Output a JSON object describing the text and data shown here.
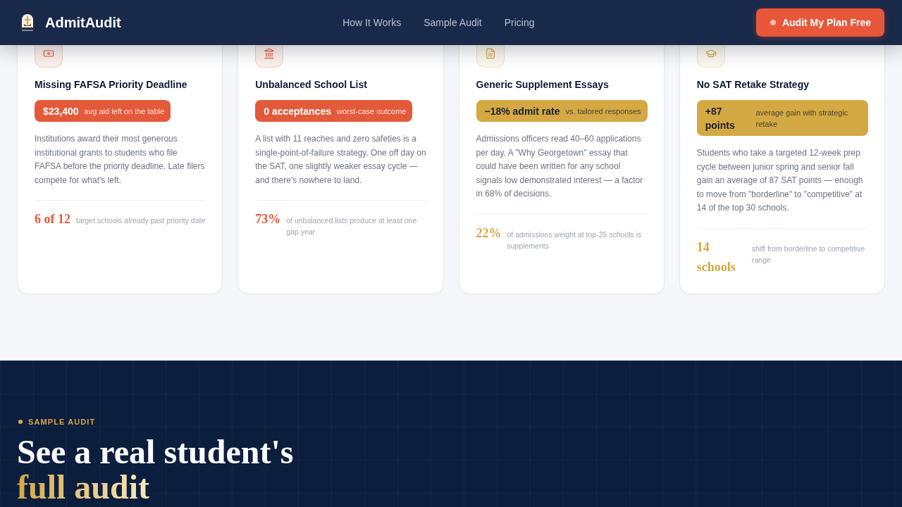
{
  "header": {
    "brand": "AdmitAudit",
    "nav": [
      {
        "label": "How It Works"
      },
      {
        "label": "Sample Audit"
      },
      {
        "label": "Pricing"
      }
    ],
    "cta": "Audit My Plan Free"
  },
  "problems": [
    {
      "title": "Missing FAFSA Priority Deadline",
      "color": "#e35a3b",
      "badge": {
        "value": "$23,400",
        "note": "avg aid left on the table"
      },
      "body": "Institutions award their most generous institutional grants to students who file FAFSA before the priority deadline. Late filers compete for what's left.",
      "stat": {
        "value": "6 of 12",
        "note": "target schools already past priority date"
      }
    },
    {
      "title": "Unbalanced School List",
      "color": "#e35a3b",
      "badge": {
        "value": "0 acceptances",
        "note": "worst-case outcome"
      },
      "body": "A list with 11 reaches and zero safeties is a single-point-of-failure strategy. One off day on the SAT, one slightly weaker essay cycle — and there's nowhere to land.",
      "stat": {
        "value": "73%",
        "note": "of unbalanced lists produce at least one gap year"
      }
    },
    {
      "title": "Generic Supplement Essays",
      "color": "#d4a843",
      "badge": {
        "value": "−18% admit rate",
        "note": "vs. tailored responses"
      },
      "body": "Admissions officers read 40–60 applications per day. A \"Why Georgetown\" essay that could have been written for any school signals low demonstrated interest — a factor in 68% of decisions.",
      "stat": {
        "value": "22%",
        "note": "of admissions weight at top-25 schools is supplements"
      }
    },
    {
      "title": "No SAT Retake Strategy",
      "color": "#d4a843",
      "badge": {
        "value": "+87 points",
        "note": "average gain with strategic retake"
      },
      "body": "Students who take a targeted 12-week prep cycle between junior spring and senior fall gain an average of 87 SAT points — enough to move from \"borderline\" to \"competitive\" at 14 of the top 30 schools.",
      "stat": {
        "value": "14 schools",
        "note": "shift from borderline to competitive range"
      }
    }
  ],
  "sample_section": {
    "eyebrow": "SAMPLE AUDIT",
    "headline": "See a real student's",
    "headline_accent": "full audit"
  }
}
